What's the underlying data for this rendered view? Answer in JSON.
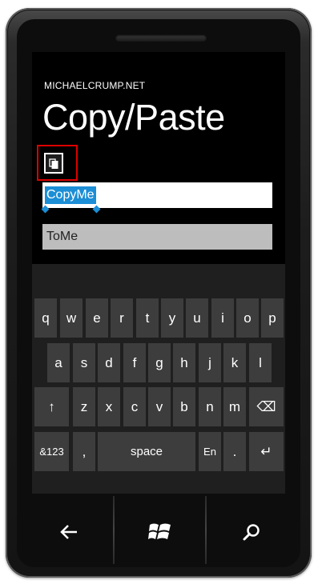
{
  "app": {
    "name": "MICHAELCRUMP.NET",
    "title": "Copy/Paste"
  },
  "fields": {
    "copy_text": "CopyMe",
    "target_text": "ToMe"
  },
  "keyboard": {
    "row1": [
      "q",
      "w",
      "e",
      "r",
      "t",
      "y",
      "u",
      "i",
      "o",
      "p"
    ],
    "row2": [
      "a",
      "s",
      "d",
      "f",
      "g",
      "h",
      "j",
      "k",
      "l"
    ],
    "row3": [
      "↑",
      "z",
      "x",
      "c",
      "v",
      "b",
      "n",
      "m",
      "⌫"
    ],
    "row4": [
      "&123",
      ",",
      "space",
      "En",
      ".",
      "↵"
    ]
  },
  "hardware": {
    "buttons": [
      "back-icon",
      "windows-icon",
      "search-icon"
    ]
  },
  "colors": {
    "selection": "#1b8ed6",
    "highlight_border": "#dd0000",
    "key": "#3d3d3d"
  }
}
